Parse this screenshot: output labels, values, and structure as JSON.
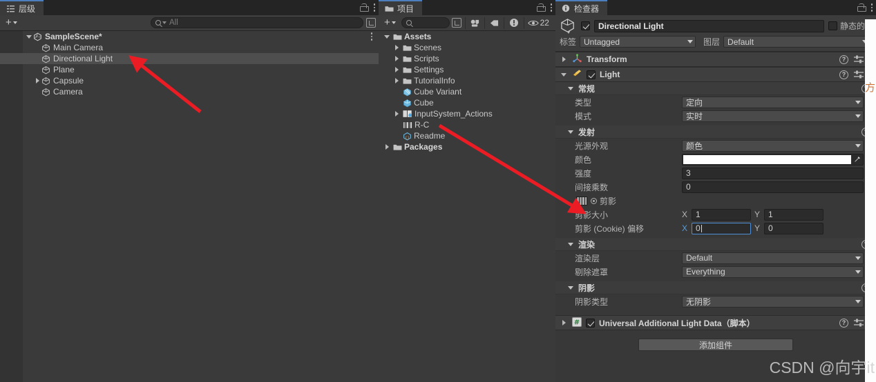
{
  "hierarchy": {
    "tab_label": "层级",
    "tab_icon": "hierarchy-icon",
    "add_label": "+",
    "search_placeholder": "All",
    "scene_name": "SampleScene*",
    "items": [
      {
        "label": "Main Camera",
        "indent": 2,
        "expandable": false
      },
      {
        "label": "Directional Light",
        "indent": 2,
        "expandable": false,
        "selected": true
      },
      {
        "label": "Plane",
        "indent": 2,
        "expandable": false
      },
      {
        "label": "Capsule",
        "indent": 2,
        "expandable": true
      },
      {
        "label": "Camera",
        "indent": 2,
        "expandable": false
      }
    ]
  },
  "project": {
    "tab_label": "项目",
    "tab_icon": "folder-icon",
    "add_label": "+",
    "search_placeholder": "",
    "visible_count": "22",
    "items": [
      {
        "label": "Assets",
        "indent": 0,
        "arrow": "open",
        "icon": "folder-icon",
        "bold": true
      },
      {
        "label": "Scenes",
        "indent": 1,
        "arrow": "closed",
        "icon": "folder-icon",
        "bold": false
      },
      {
        "label": "Scripts",
        "indent": 1,
        "arrow": "closed",
        "icon": "folder-icon",
        "bold": false
      },
      {
        "label": "Settings",
        "indent": 1,
        "arrow": "closed",
        "icon": "folder-icon",
        "bold": false
      },
      {
        "label": "TutorialInfo",
        "indent": 1,
        "arrow": "closed",
        "icon": "folder-icon",
        "bold": false
      },
      {
        "label": "Cube Variant",
        "indent": 1,
        "arrow": "none",
        "icon": "prefab-variant-icon",
        "bold": false
      },
      {
        "label": "Cube",
        "indent": 1,
        "arrow": "none",
        "icon": "prefab-icon",
        "bold": false
      },
      {
        "label": "InputSystem_Actions",
        "indent": 1,
        "arrow": "closed",
        "icon": "input-actions-icon",
        "bold": false
      },
      {
        "label": "R-C",
        "indent": 1,
        "arrow": "none",
        "icon": "texture-icon",
        "bold": false
      },
      {
        "label": "Readme",
        "indent": 1,
        "arrow": "none",
        "icon": "scriptable-object-icon",
        "bold": false
      },
      {
        "label": "Packages",
        "indent": 0,
        "arrow": "closed",
        "icon": "folder-icon",
        "bold": true
      }
    ]
  },
  "inspector": {
    "tab_label": "检查器",
    "tab_icon": "info-icon",
    "object_name": "Directional Light",
    "object_enabled": true,
    "static_label": "静态的",
    "static_checked": false,
    "tag_label": "标签",
    "tag_value": "Untagged",
    "layer_label": "图层",
    "layer_value": "Default",
    "components": [
      {
        "name": "Transform",
        "icon": "transform-icon",
        "expanded": false,
        "has_checkbox": false
      },
      {
        "name": "Light",
        "icon": "light-icon",
        "expanded": true,
        "has_checkbox": true,
        "checked": true
      }
    ],
    "light": {
      "sections": [
        {
          "title": "常规",
          "rows": [
            {
              "label": "类型",
              "type": "dropdown",
              "value": "定向"
            },
            {
              "label": "模式",
              "type": "dropdown",
              "value": "实时"
            }
          ]
        },
        {
          "title": "发射",
          "rows": [
            {
              "label": "光源外观",
              "type": "dropdown",
              "value": "颜色"
            },
            {
              "label": "颜色",
              "type": "color",
              "value": "#ffffff"
            },
            {
              "label": "强度",
              "type": "number",
              "value": "3"
            },
            {
              "label": "间接乘数",
              "type": "number",
              "value": "0"
            },
            {
              "label": "剪影",
              "type": "cookie-header"
            },
            {
              "label": "剪影大小",
              "type": "vector2",
              "x": "1",
              "y": "1",
              "focused": false
            },
            {
              "label": "剪影 (Cookie) 偏移",
              "type": "vector2",
              "x": "0",
              "y": "0",
              "focused": true
            }
          ]
        },
        {
          "title": "渲染",
          "rows": [
            {
              "label": "渲染层",
              "type": "dropdown",
              "value": "Default"
            },
            {
              "label": "剔除遮罩",
              "type": "dropdown",
              "value": "Everything"
            }
          ]
        },
        {
          "title": "阴影",
          "rows": [
            {
              "label": "阴影类型",
              "type": "dropdown",
              "value": "无阴影"
            }
          ]
        }
      ]
    },
    "script_component": {
      "name": "Universal Additional Light Data（脚本）",
      "icon": "csharp-script-icon",
      "checked": true
    },
    "add_component_label": "添加组件"
  },
  "watermark": "CSDN @向宇it",
  "colors": {
    "panel_bg": "#3a3a3a",
    "tab_bg": "#242424",
    "accent_blue": "#4d7fbf",
    "selection": "#4e4e4e",
    "arrow_red": "#ec1c24"
  }
}
